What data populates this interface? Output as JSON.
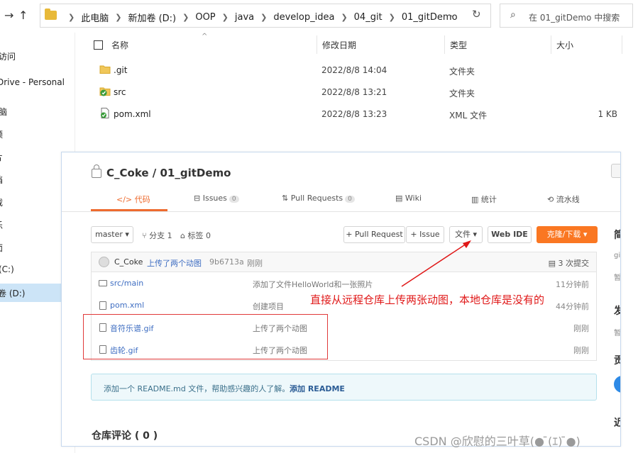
{
  "explorer": {
    "breadcrumbs": [
      "此电脑",
      "新加卷 (D:)",
      "OOP",
      "java",
      "develop_idea",
      "04_git",
      "01_gitDemo"
    ],
    "search_placeholder": "在 01_gitDemo 中搜索",
    "sidebar": [
      "访问",
      "Drive - Personal",
      "脑",
      "频",
      "片",
      "档",
      "载",
      "乐",
      "面",
      "(C:)",
      "卷 (D:)"
    ],
    "columns": {
      "name": "名称",
      "date": "修改日期",
      "type": "类型",
      "size": "大小"
    },
    "files": [
      {
        "name": ".git",
        "date": "2022/8/8 14:04",
        "type": "文件夹",
        "size": "",
        "icon": "folder-icon"
      },
      {
        "name": "src",
        "date": "2022/8/8 13:21",
        "type": "文件夹",
        "size": "",
        "icon": "git-folder-icon"
      },
      {
        "name": "pom.xml",
        "date": "2022/8/8 13:23",
        "type": "XML 文件",
        "size": "1 KB",
        "icon": "xml-file-icon"
      }
    ]
  },
  "gitee": {
    "repo_title": "C_Coke / 01_gitDemo",
    "tabs": [
      {
        "label": "</> 代码",
        "count": ""
      },
      {
        "label": "Issues",
        "count": "0"
      },
      {
        "label": "Pull Requests",
        "count": "0"
      },
      {
        "label": "Wiki",
        "count": ""
      },
      {
        "label": "统计",
        "count": ""
      },
      {
        "label": "流水线",
        "count": ""
      }
    ],
    "branch": "master",
    "branch_count": "分支 1",
    "tag_count": "标签 0",
    "buttons": {
      "pull_request": "+ Pull Request",
      "issue": "+ Issue",
      "file": "文件",
      "web_ide": "Web IDE",
      "clone": "克隆/下载"
    },
    "commit": {
      "author": "C_Coke",
      "message": "上传了两个动图",
      "hash": "9b6713a",
      "time": "刚刚",
      "commits": "3 次提交"
    },
    "rows": [
      {
        "name": "src/main",
        "message": "添加了文件HelloWorld和一张照片",
        "time": "11分钟前",
        "kind": "folder"
      },
      {
        "name": "pom.xml",
        "message": "创建项目",
        "time": "44分钟前",
        "kind": "file"
      },
      {
        "name": "音符乐谱.gif",
        "message": "上传了两个动图",
        "time": "刚刚",
        "kind": "file"
      },
      {
        "name": "齿轮.gif",
        "message": "上传了两个动图",
        "time": "刚刚",
        "kind": "file"
      }
    ],
    "readme_prompt": "添加一个 README.md 文件，帮助感兴趣的人了解。",
    "readme_link": "添加 README",
    "comments_title": "仓库评论 ( 0 )",
    "right_labels": [
      "简",
      "发",
      "贡",
      "近"
    ],
    "right_small": [
      "git",
      "暂",
      "暂"
    ]
  },
  "annotation": "直接从远程仓库上传两张动图，本地仓库是没有的",
  "watermark": "CSDN @欣慰的三叶草(● ̄(ｴ) ̄●)",
  "colors": {
    "accent": "#fa7722",
    "annotation": "#e01818",
    "link": "#3f6ec2"
  }
}
